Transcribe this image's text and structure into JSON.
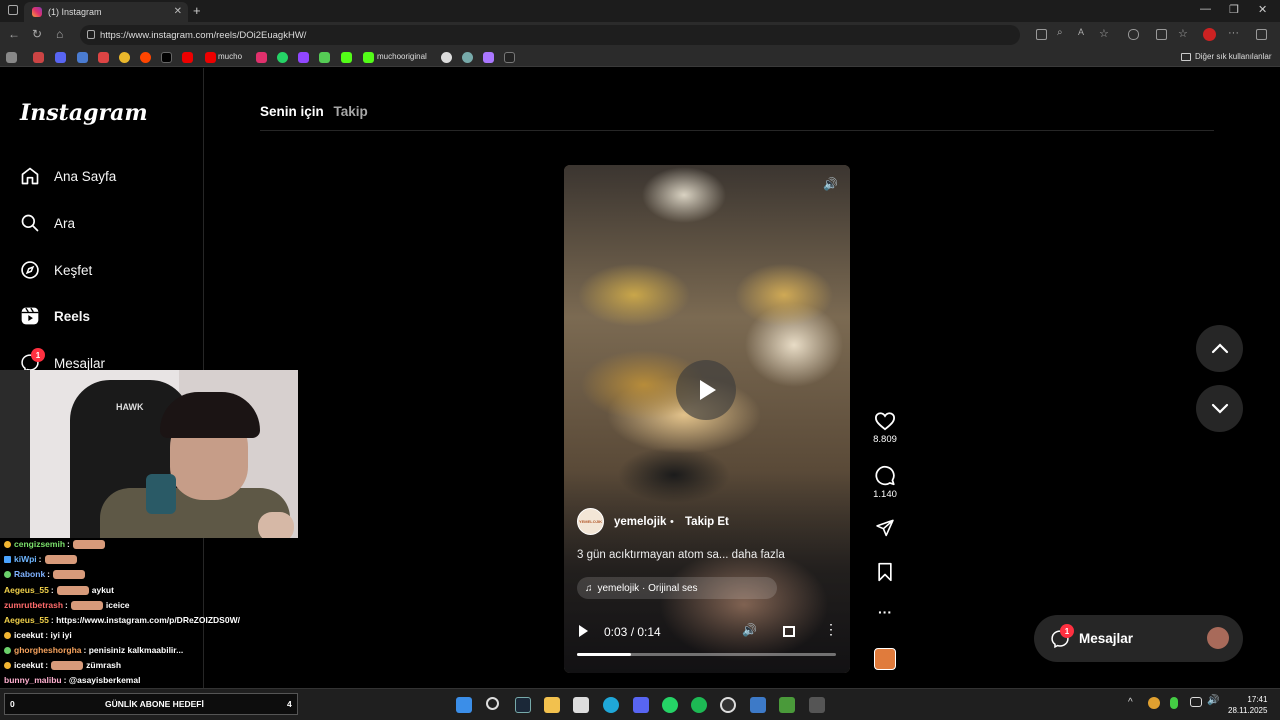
{
  "browser": {
    "tab_title": "(1) Instagram",
    "url": "https://www.instagram.com/reels/DOi2EuagkHW/",
    "bookmarks": [
      "mucho",
      "muchooriginal",
      "Diğer sık kullanılanlar"
    ]
  },
  "sidebar": {
    "logo": "Instagram",
    "items": [
      {
        "label": "Ana Sayfa",
        "icon": "home-icon"
      },
      {
        "label": "Ara",
        "icon": "search-icon"
      },
      {
        "label": "Keşfet",
        "icon": "compass-icon"
      },
      {
        "label": "Reels",
        "icon": "reels-icon"
      },
      {
        "label": "Mesajlar",
        "icon": "messenger-icon",
        "badge": "1"
      }
    ]
  },
  "feed_tabs": [
    "Senin için",
    "Takip"
  ],
  "reel": {
    "username": "yemelojik",
    "follow_label": "Takip Et",
    "caption": "3 gün acıktırmayan atom sa... daha fazla",
    "audio": "yemelojik · Orijinal ses",
    "time": "0:03 / 0:14",
    "progress": 0.21,
    "likes": "8.809",
    "comments": "1.140"
  },
  "messages_bubble": {
    "label": "Mesajlar",
    "badge": "1"
  },
  "chat": [
    {
      "user": "cengizsemih",
      "color": "#7be06b",
      "text": ""
    },
    {
      "user": "kiWpi",
      "color": "#6fb6ff",
      "text": ""
    },
    {
      "user": "Rabonk",
      "color": "#7fb2ff",
      "text": ""
    },
    {
      "user": "Aegeus_55",
      "color": "#f2d24b",
      "text": "aykut"
    },
    {
      "user": "zumrutbetrash",
      "color": "#ff6b6b",
      "text": "iceice"
    },
    {
      "user": "Aegeus_55",
      "color": "#f2d24b",
      "text": "https://www.instagram.com/p/DReZOIZDS0W/"
    },
    {
      "user": "iceekut",
      "color": "#ffffff",
      "text": "iyi iyi"
    },
    {
      "user": "ghorgheshorgha",
      "color": "#f5a25d",
      "text": "penisiniz kalkmaabilir..."
    },
    {
      "user": "iceekut",
      "color": "#ffffff",
      "text": "zümrash"
    },
    {
      "user": "bunny_malibu",
      "color": "#ffb0d0",
      "text": "@asayisberkemal"
    }
  ],
  "goal_bar": {
    "left": "0",
    "label": "GÜNLİK ABONE HEDEFİ",
    "right": "4"
  },
  "clock": {
    "time": "17:41",
    "date": "28.11.2025"
  }
}
